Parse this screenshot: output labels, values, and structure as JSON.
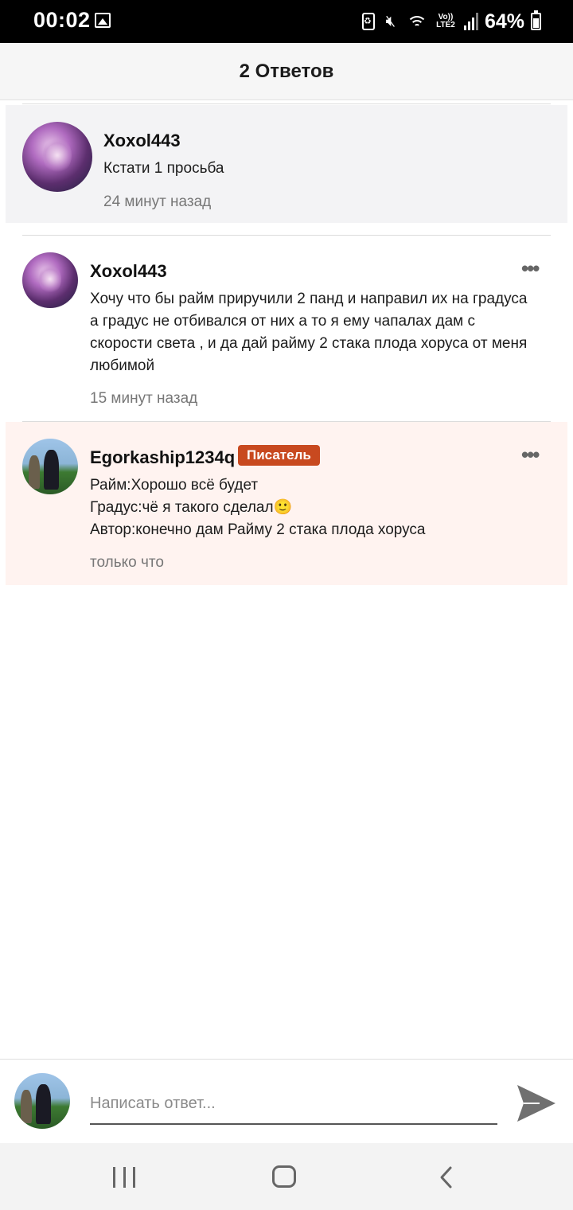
{
  "status_bar": {
    "time": "00:02",
    "network": "Vo)) LTE2",
    "battery": "64%",
    "icons": [
      "gallery-icon",
      "battery-saver-icon",
      "mute-icon",
      "wifi-icon",
      "signal-icon",
      "battery-icon"
    ]
  },
  "header": {
    "title": "2 Ответов"
  },
  "parent_comment": {
    "username": "Xoxol443",
    "text": "Кстати 1 просьба",
    "time": "24 минут назад"
  },
  "replies": [
    {
      "username": "Xoxol443",
      "text_lines": [
        "Хочу что бы райм приручили 2 панд и направил их на градуса",
        "а градус не отбивался от них а то я ему чапалах дам с",
        "скорости света , и да дай райму 2 стака плода хоруса от меня",
        "любимой"
      ],
      "time": "15 минут назад",
      "more_icon": "more-horizontal-icon"
    },
    {
      "username": "Egorkaship1234q",
      "badge": "Писатель",
      "text_lines": [
        "Райм:Хорошо всё будет",
        "Градус:чё я такого сделал🙂",
        "Автор:конечно дам Райму 2 стака плода хоруса"
      ],
      "time": "только что",
      "more_icon": "more-horizontal-icon"
    }
  ],
  "composer": {
    "placeholder": "Написать ответ...",
    "value": "",
    "send_icon": "send-icon"
  },
  "nav": {
    "icons": [
      "recent-apps-icon",
      "home-icon",
      "back-icon"
    ]
  },
  "colors": {
    "badge": "#c8491f",
    "highlight_parent": "#f3f3f5",
    "highlight_new": "#fff3f0"
  }
}
